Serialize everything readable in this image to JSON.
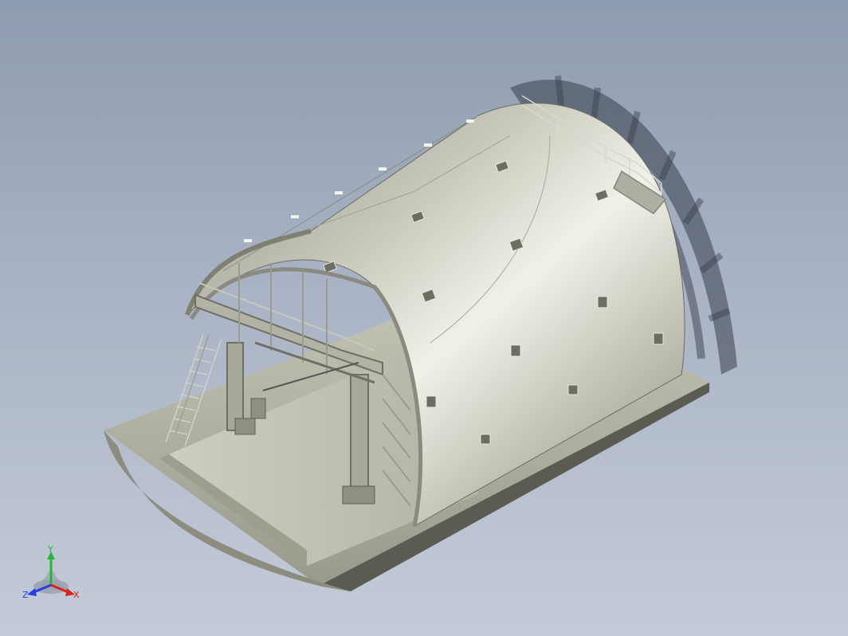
{
  "viewport": {
    "background_top": "#8e9aaf",
    "background_bottom": "#c4cbd8"
  },
  "model": {
    "description_icon": "tunnel-formwork-model",
    "shell_color": "#b9b9ad",
    "base_color": "#b6b6a6",
    "shadow_color": "#2b2f3a"
  },
  "triad": {
    "x_label": "X",
    "y_label": "Y",
    "z_label": "Z",
    "x_color": "#d8231f",
    "y_color": "#26b53a",
    "z_color": "#2a3ee0"
  }
}
